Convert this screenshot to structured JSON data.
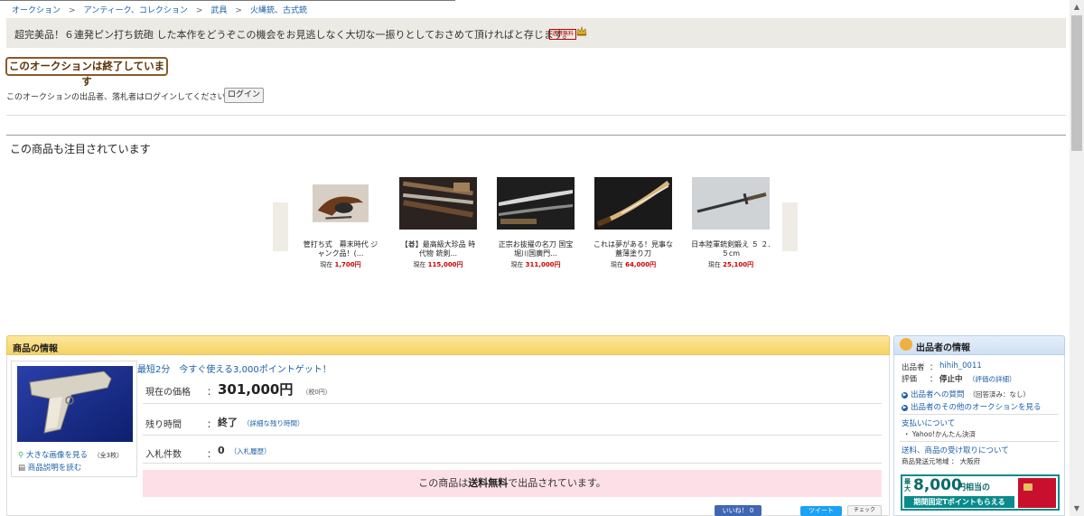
{
  "breadcrumb": [
    {
      "label": "オークション"
    },
    {
      "label": "アンティーク、コレクション"
    },
    {
      "label": "武具"
    },
    {
      "label": "火縄銃、古式銃"
    }
  ],
  "breadcrumb_sep": ">",
  "title": {
    "text": "超完美品！６連発ピン打ち銃砲 した本作をどうぞこの機会をお見逃しなく大切な一振りとしておさめて頂ければと存じます。",
    "shipping_badge": "送料無料"
  },
  "status": {
    "ended_label": "このオークションは終了しています",
    "login_message": "このオークションの出品者、落札者はログインしてください。",
    "login_button": "ログイン"
  },
  "recommendations": {
    "title": "この商品も注目されています",
    "price_prefix": "現在",
    "items": [
      {
        "name": "管打ち式　幕末時代 ジャンク品！(...",
        "price": "1,700円"
      },
      {
        "name": "【碁】最高級大珍品 時代物 銃剣...",
        "price": "115,000円"
      },
      {
        "name": "正宗お抜擢の名刀 国宝　堀川国廣門...",
        "price": "311,000円"
      },
      {
        "name": "これは夢がある！見事な 蓋薄塗り刀",
        "price": "64,000円"
      },
      {
        "name": "日本陸軍銃剣鍛え ５ ２.５cm",
        "price": "25,100円"
      }
    ]
  },
  "product": {
    "header": "商品の情報",
    "large_image_link": "大きな画像を見る",
    "image_count": "（全3枚）",
    "description_link": "商品説明を読む",
    "promo": "最短2分　今すぐ使える3,000ポイントゲット！",
    "price_label": "現在の価格",
    "price_value": "301,000円",
    "price_tax": "（税0円）",
    "remaining_label": "残り時間",
    "remaining_value": "終了",
    "remaining_link": "（詳細な残り時間）",
    "bids_label": "入札件数",
    "bids_value": "0",
    "bids_link": "（入札履歴）",
    "colon": "：",
    "free_ship_prefix": "この商品は",
    "free_ship_bold": "送料無料",
    "free_ship_suffix": "で出品されています。",
    "like_button": "いいね！ 0",
    "tweet_button": "ツイート",
    "check_button": "チェック"
  },
  "seller": {
    "header": "出品者の情報",
    "seller_label": "出品者",
    "seller_name": "hihih_0011",
    "rating_label": "評価",
    "colon": "：",
    "rating_value": "停止中",
    "rating_link": "（評価の詳細）",
    "question_link": "出品者への質問",
    "question_note": "（回答済み：なし）",
    "other_auctions_link": "出品者のその他のオークションを見る",
    "payment_title": "支払いについて",
    "payment_method": "・ Yahoo!かんたん決済",
    "shipping_title": "送料、商品の受け取りについて",
    "ship_from_label": "商品発送元地域",
    "ship_from_value": "大阪府",
    "banner_prefix": "最大",
    "banner_amount": "8,000",
    "banner_text1": "円相当の",
    "banner_text2": "期間固定Tポイントもらえる"
  },
  "colors": {
    "accent_link": "#1a5ea8",
    "price_red": "#cc0000",
    "product_header": "#f6d265",
    "seller_header": "#cfe0f3",
    "free_ship_bg": "#fde0e7"
  }
}
